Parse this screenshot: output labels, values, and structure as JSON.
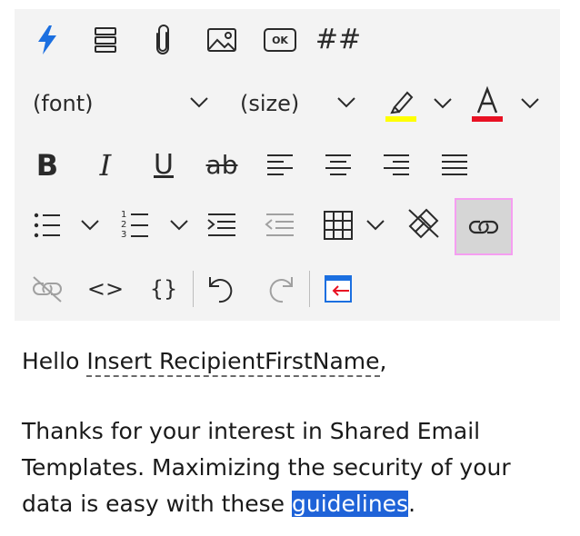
{
  "toolbar": {
    "font_dropdown": "(font)",
    "size_dropdown": "(size)",
    "icons": {
      "quick": "lightning-icon",
      "row1": [
        "lightning-icon",
        "list-layers-icon",
        "paperclip-icon",
        "image-icon",
        "ok-button-icon",
        "hashtag-icon"
      ],
      "row3": [
        "bold-icon",
        "italic-icon",
        "underline-icon",
        "strikethrough-icon",
        "align-left-icon",
        "align-center-icon",
        "align-right-icon",
        "justify-icon"
      ],
      "row4": [
        "bulleted-list-icon",
        "numbered-list-icon",
        "increase-indent-icon",
        "decrease-indent-icon",
        "table-icon",
        "clear-format-icon",
        "link-icon"
      ],
      "row5": [
        "unlink-icon",
        "code-view-icon",
        "braces-icon",
        "undo-icon",
        "redo-icon",
        "insert-template-icon"
      ]
    },
    "bold_label": "B",
    "italic_label": "I",
    "underline_label": "U",
    "strike_label": "ab",
    "hash_label": "##",
    "ok_label": "OK",
    "numbered_digits": "123",
    "code_label": "<>",
    "braces_label": "{}",
    "highlight_color": "#ffff00",
    "font_color": "#e81123",
    "accent": "#1f63d8"
  },
  "editor": {
    "greeting_prefix": "Hello ",
    "placeholder_field": "Insert RecipientFirstName",
    "greeting_suffix": ",",
    "body_before_link": "Thanks for your interest in Shared Email Templates. Maximizing the security of your data is easy with these ",
    "selected_link_text": "guidelines",
    "body_after_link": "."
  }
}
